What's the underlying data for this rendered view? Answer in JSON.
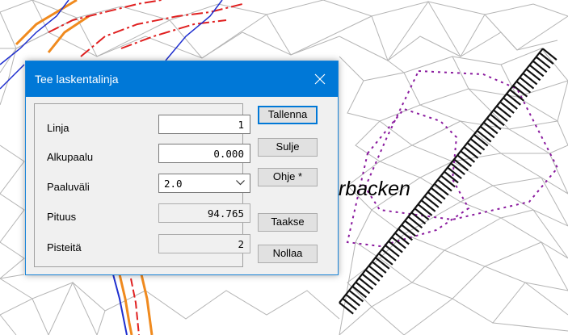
{
  "map": {
    "place_label": "rbacken"
  },
  "dialog": {
    "title": "Tee laskentalinja",
    "rows": [
      {
        "label": "Linja",
        "value": "1"
      },
      {
        "label": "Alkupaalu",
        "value": "0.000"
      },
      {
        "label": "Paaluväli",
        "value": "2.0"
      },
      {
        "label": "Pituus",
        "value": "94.765"
      },
      {
        "label": "Pisteitä",
        "value": "2"
      }
    ],
    "buttons": {
      "save": "Tallenna",
      "close": "Sulje",
      "help": "Ohje *",
      "back": "Taakse",
      "reset": "Nollaa"
    }
  },
  "colors": {
    "titlebar": "#0078d7",
    "triangulation": "#b4b4b4",
    "breakline_red": "#e02020",
    "breakline_orange": "#f08a1e",
    "breakline_blue": "#1f2fcf",
    "area_outline_purple": "#8a1a9e"
  }
}
